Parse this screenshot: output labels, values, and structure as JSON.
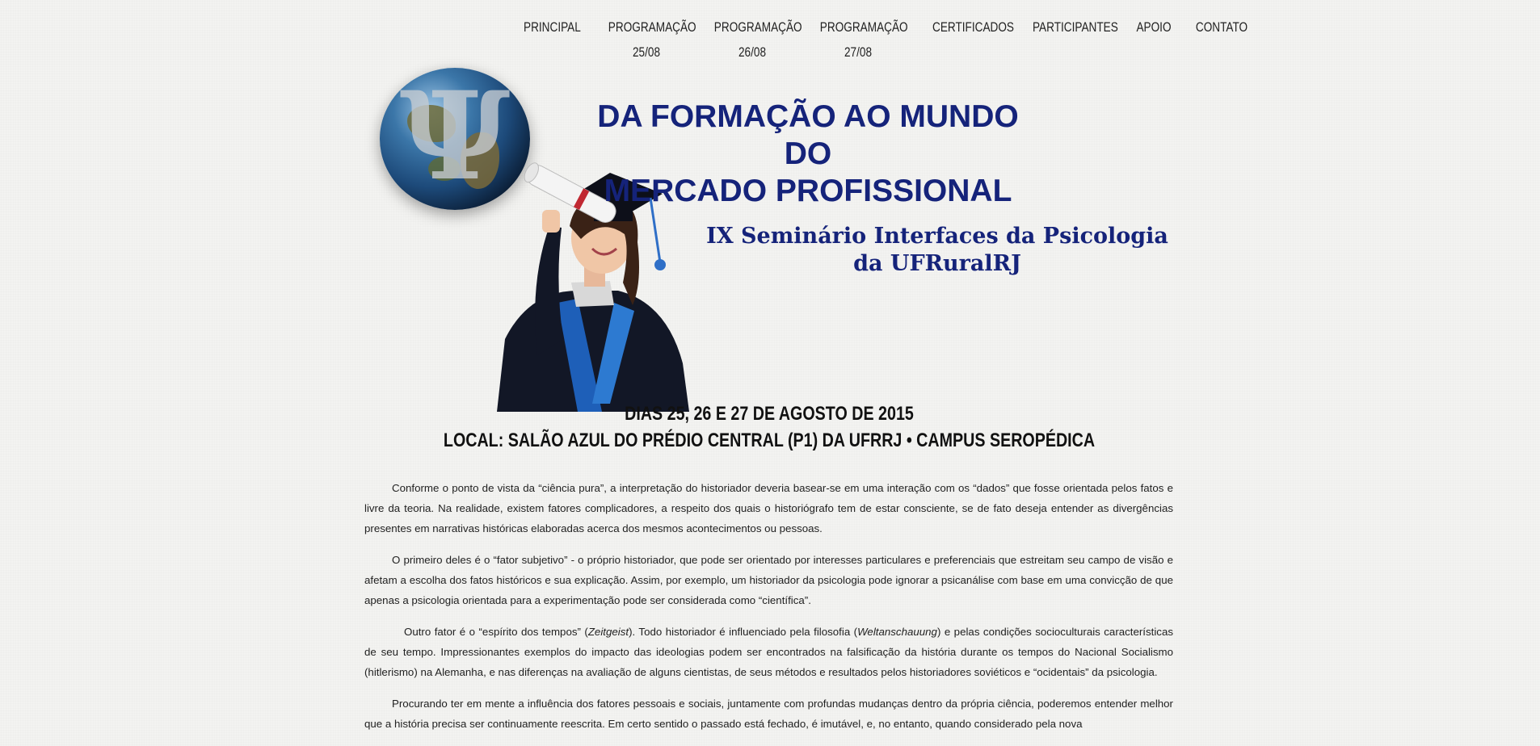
{
  "nav": {
    "items": [
      {
        "lines": [
          "PRINCIPAL"
        ]
      },
      {
        "lines": [
          "PROGRAMAÇÃO",
          "25/08"
        ]
      },
      {
        "lines": [
          "PROGRAMAÇÃO",
          "26/08"
        ]
      },
      {
        "lines": [
          "PROGRAMAÇÃO",
          "27/08"
        ]
      },
      {
        "lines": [
          "CERTIFICADOS"
        ]
      },
      {
        "lines": [
          "PARTICIPANTES"
        ]
      },
      {
        "lines": [
          "APOIO"
        ]
      },
      {
        "lines": [
          "CONTATO"
        ]
      }
    ]
  },
  "hero": {
    "title_line1": "DA FORMAÇÃO AO MUNDO DO",
    "title_line2": "MERCADO PROFISSIONAL",
    "subtitle_line1": "IX Seminário Interfaces da Psicologia",
    "subtitle_line2": "da UFRuralRJ",
    "logo_icon": "psi-globe-icon",
    "image_icon": "graduate-with-telescope-icon",
    "title_color": "#15237a"
  },
  "event": {
    "dates": "DIAS 25, 26 E 27 DE AGOSTO DE 2015",
    "location": "LOCAL: SALÃO AZUL DO PRÉDIO CENTRAL (P1) DA UFRRJ • CAMPUS SEROPÉDICA"
  },
  "content": {
    "p1": "Conforme o ponto de vista da “ciência pura”, a interpretação do historiador deveria basear-se em uma interação com os “dados” que fosse orientada pelos fatos e livre da teoria. Na realidade, existem fatores complicadores, a respeito dos quais o historiógrafo tem de estar consciente, se de fato deseja entender as divergências presentes em narrativas históricas elaboradas acerca dos mesmos acontecimentos ou pessoas.",
    "p2": "O primeiro deles é o “fator subjetivo” - o próprio historiador, que pode ser orientado por interesses particulares e preferenciais que estreitam seu campo de visão e afetam a escolha dos fatos históricos e sua explicação. Assim, por exemplo, um historiador da psicologia pode ignorar a psicanálise com base em uma convicção de que apenas a psicologia orientada para a experimentação pode ser considerada como “científica”.",
    "p3_a": "Outro fator é o “espírito dos tempos” (",
    "p3_zeitgeist": "Zeitgeist",
    "p3_b": "). Todo historiador é influenciado pela filosofia (",
    "p3_weltanschauung": "Weltanschauung",
    "p3_c": ") e pelas condições socioculturais características de seu tempo. Impressionantes exemplos do impacto das ideologias podem ser encontrados na falsificação da história durante os tempos do Nacional Socialismo (hitlerismo) na Alemanha, e nas diferenças na avaliação de alguns cientistas, de seus métodos e resultados pelos historiadores soviéticos e “ocidentais” da psicologia.",
    "p4": "Procurando ter em mente a influência dos fatores pessoais e sociais, juntamente com profundas mudanças dentro da própria ciência, poderemos entender melhor que a história precisa ser continuamente reescrita. Em certo sentido o passado está fechado, é imutável, e, no entanto, quando considerado pela nova"
  }
}
